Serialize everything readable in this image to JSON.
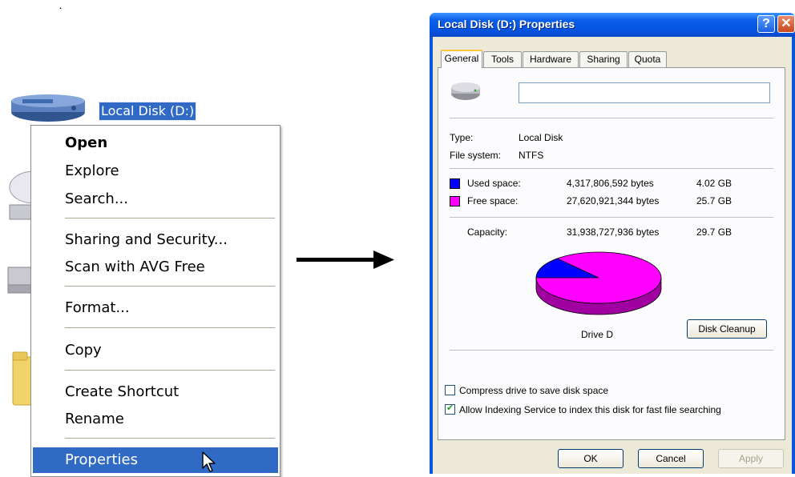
{
  "desktop": {
    "stray_mark": "ฺ",
    "drive_label": "Local Disk (D:)"
  },
  "context_menu": {
    "items": [
      {
        "label": "Open",
        "bold": true
      },
      {
        "label": "Explore"
      },
      {
        "label": "Search..."
      },
      {
        "label": "Sharing and Security..."
      },
      {
        "label": "Scan with AVG Free"
      },
      {
        "label": "Format..."
      },
      {
        "label": "Copy"
      },
      {
        "label": "Create Shortcut"
      },
      {
        "label": "Rename"
      },
      {
        "label": "Properties",
        "selected": true
      }
    ]
  },
  "dialog": {
    "title": "Local Disk (D:) Properties",
    "help_glyph": "?",
    "close_glyph": "✕",
    "tabs": [
      "General",
      "Tools",
      "Hardware",
      "Sharing",
      "Quota"
    ],
    "active_tab": "General",
    "name_value": "",
    "type_label": "Type:",
    "type_value": "Local Disk",
    "fs_label": "File system:",
    "fs_value": "NTFS",
    "used_label": "Used space:",
    "used_bytes": "4,317,806,592 bytes",
    "used_gb": "4.02 GB",
    "free_label": "Free space:",
    "free_bytes": "27,620,921,344 bytes",
    "free_gb": "25.7 GB",
    "capacity_label": "Capacity:",
    "capacity_bytes": "31,938,727,936 bytes",
    "capacity_gb": "29.7 GB",
    "drive_caption": "Drive D",
    "disk_cleanup": "Disk Cleanup",
    "compress_label": "Compress drive to save disk space",
    "compress_checked": false,
    "index_label": "Allow Indexing Service to index this disk for fast file searching",
    "index_checked": true,
    "ok": "OK",
    "cancel": "Cancel",
    "apply": "Apply",
    "used_color": "#0000ff",
    "free_color": "#ff00ff",
    "used_fraction": 0.135
  }
}
